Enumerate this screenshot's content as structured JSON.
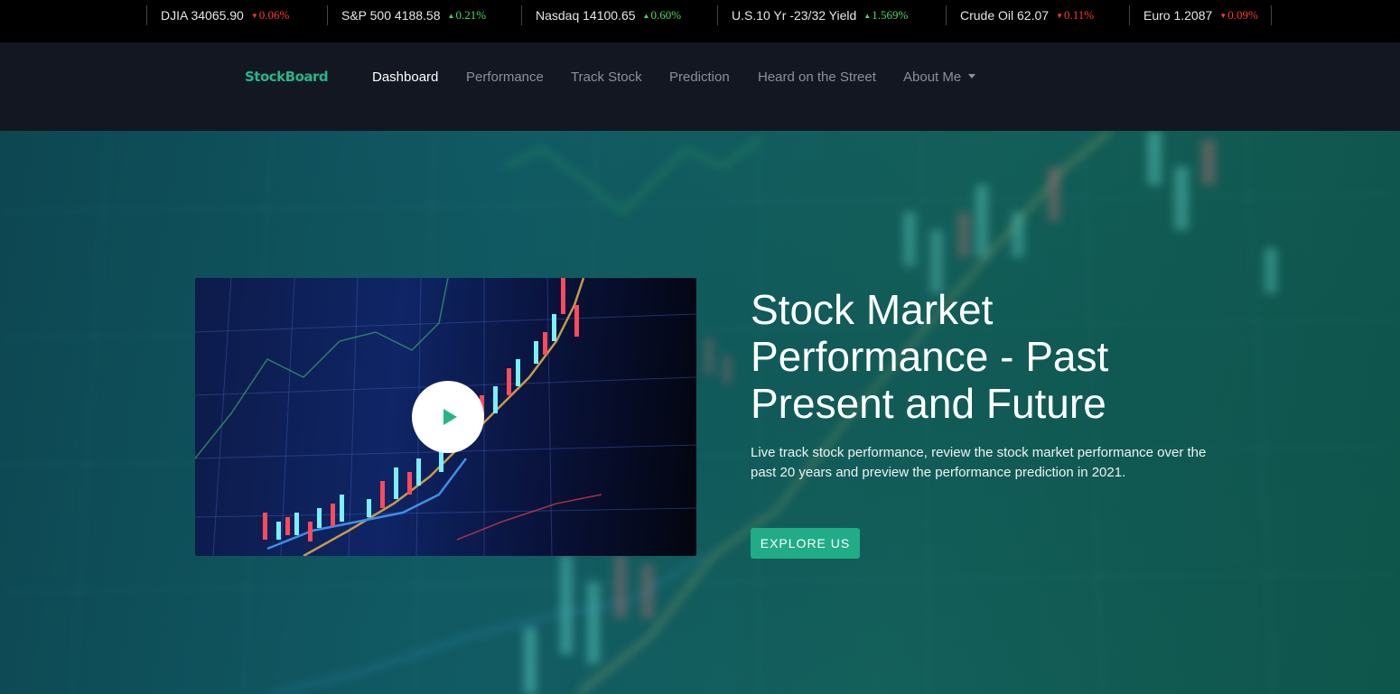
{
  "ticker": [
    {
      "name": "DJIA 34065.90",
      "direction": "down",
      "change": "0.06%"
    },
    {
      "name": "S&P 500 4188.58",
      "direction": "up",
      "change": "0.21%"
    },
    {
      "name": "Nasdaq 14100.65",
      "direction": "up",
      "change": "0.60%"
    },
    {
      "name": "U.S.10 Yr -23/32 Yield",
      "direction": "up",
      "change": "1.569%"
    },
    {
      "name": "Crude Oil 62.07",
      "direction": "down",
      "change": "0.11%"
    },
    {
      "name": "Euro 1.2087",
      "direction": "down",
      "change": "0.09%"
    }
  ],
  "navbar": {
    "brand": "StockBoard",
    "links": [
      "Dashboard",
      "Performance",
      "Track Stock",
      "Prediction",
      "Heard on the Street",
      "About Me"
    ],
    "active": "Dashboard"
  },
  "hero": {
    "title": "Stock Market Performance - Past Present and Future",
    "description": "Live track stock performance, review the stock market performance over the past 20 years and preview the performance prediction in 2021.",
    "cta": "EXPLORE US",
    "video_icon": "play-icon"
  },
  "colors": {
    "accent": "#20ac87",
    "brand": "#26b58a",
    "up": "#4cd964",
    "down": "#ff3b30",
    "navbar_bg": "#131722"
  }
}
